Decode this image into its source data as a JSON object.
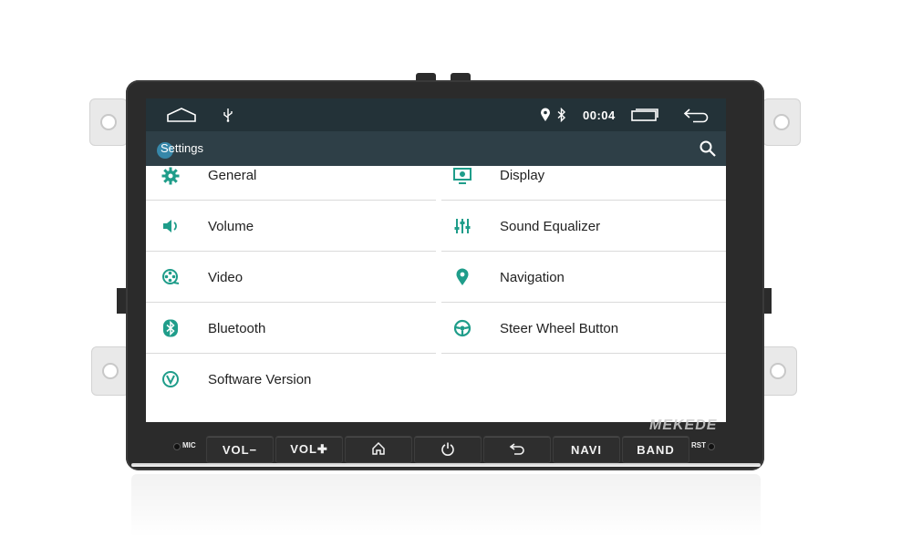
{
  "statusbar": {
    "time": "00:04",
    "icons": [
      "home-outline-icon",
      "usb-icon",
      "location-pin-icon",
      "bluetooth-icon",
      "recent-apps-icon",
      "back-icon"
    ]
  },
  "appbar": {
    "title": "Settings",
    "search_icon": "search-icon"
  },
  "settings": {
    "left": [
      {
        "label": "General",
        "icon": "gear-icon"
      },
      {
        "label": "Volume",
        "icon": "speaker-icon"
      },
      {
        "label": "Video",
        "icon": "film-reel-icon"
      },
      {
        "label": "Bluetooth",
        "icon": "bluetooth-icon"
      },
      {
        "label": "Software Version",
        "icon": "version-icon"
      }
    ],
    "right": [
      {
        "label": "Display",
        "icon": "display-icon"
      },
      {
        "label": "Sound Equalizer",
        "icon": "equalizer-icon"
      },
      {
        "label": "Navigation",
        "icon": "location-pin-icon"
      },
      {
        "label": "Steer Wheel Button",
        "icon": "steering-wheel-icon"
      }
    ]
  },
  "hardware": {
    "mic": "MIC",
    "vol_down": "VOL−",
    "vol_up": "VOL✚",
    "navi": "NAVI",
    "band": "BAND",
    "rst": "RST",
    "brand": "MEKEDE"
  },
  "colors": {
    "statusbar": "#233238",
    "appbar": "#2e3f47",
    "accent_teal": "#1f9d8a",
    "bezel": "#2b2b2b"
  }
}
